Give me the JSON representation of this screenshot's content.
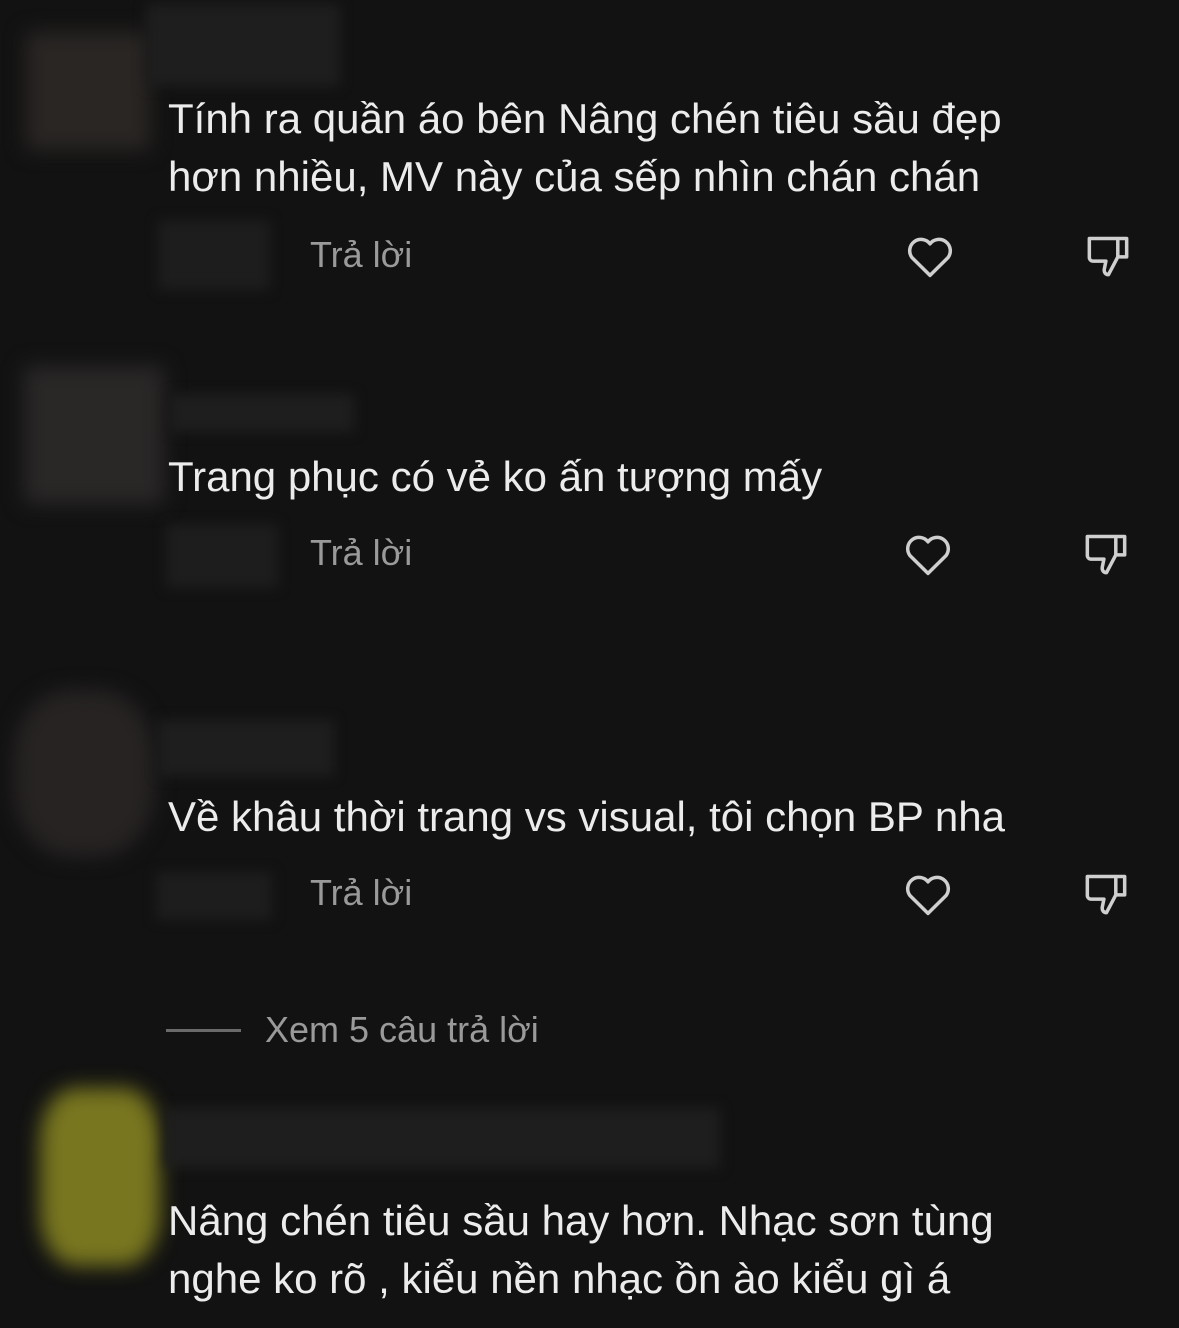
{
  "comments": [
    {
      "text_lines": [
        "Tính ra quần áo bên Nâng chén tiêu sầu đẹp",
        "hơn nhiều, MV này của sếp nhìn chán chán"
      ],
      "reply_label": "Trả lời"
    },
    {
      "text_lines": [
        "Trang phục có vẻ ko ấn tượng mấy"
      ],
      "reply_label": "Trả lời"
    },
    {
      "text_lines": [
        "Về khâu thời trang vs visual, tôi chọn BP nha"
      ],
      "reply_label": "Trả lời"
    },
    {
      "text_lines": [
        "Nâng chén tiêu sầu hay hơn. Nhạc sơn tùng",
        "nghe ko rõ , kiểu nền nhạc ồn ào kiểu gì á"
      ]
    }
  ],
  "view_replies_label": "Xem 5 câu trả lời",
  "icons": {
    "like": "heart-outline-icon",
    "dislike": "thumbs-down-outline-icon"
  },
  "colors": {
    "background": "#121212",
    "comment_text": "#ececec",
    "secondary_text": "#9a9a9a",
    "blur_mask": "#1e1e1e",
    "avatar_4": "#78761f"
  }
}
